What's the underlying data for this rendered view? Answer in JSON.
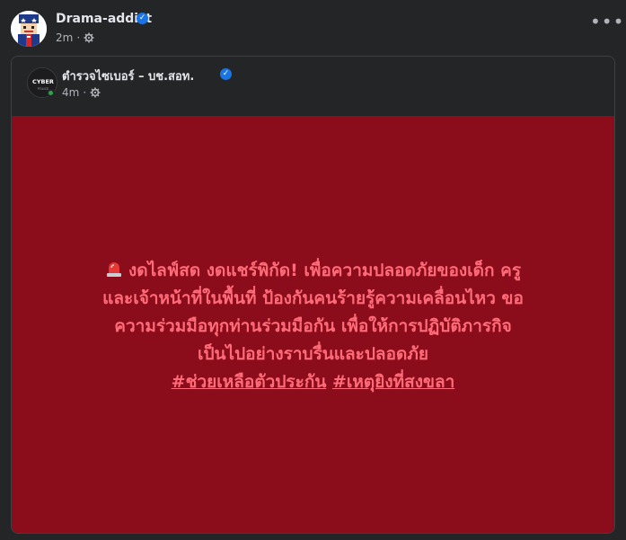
{
  "post": {
    "author": "Drama-addict",
    "time": "2m",
    "more_label": "•••"
  },
  "shared": {
    "page_name": "ตำรวจไซเบอร์ – บช.สอท.",
    "time": "4m",
    "message_lines": [
      "งดไลฟ์สด งดแชร์พิกัด! เพื่อความปลอดภัยของเด็ก ครู",
      "และเจ้าหน้าที่ในพื้นที่ ป้องกันคนร้ายรู้ความเคลื่อนไหว ขอ",
      "ความร่วมมือทุกท่านร่วมมือกัน เพื่อให้การปฏิบัติภารกิจ",
      "เป็นไปอย่างราบรื่นและปลอดภัย"
    ],
    "hashtags": [
      "#ช่วยเหลือตัวประกัน",
      "#เหตุยิงที่สงขลา"
    ],
    "colors": {
      "panel": "#8b0c1a",
      "text": "#ff6b78"
    }
  },
  "icons": {
    "verified": "verified-badge-icon",
    "audience": "gear-icon",
    "siren": "siren-icon"
  }
}
